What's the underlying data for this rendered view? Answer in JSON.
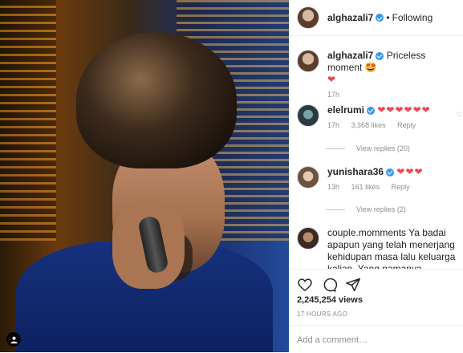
{
  "post": {
    "author": "alghazali7",
    "follow_status": "Following",
    "dot": "•"
  },
  "comments": [
    {
      "user": "alghazali7",
      "text": "Priceless moment 🤩",
      "extra": "❤",
      "time": "17h"
    },
    {
      "user": "elelrumi",
      "text": "❤❤❤❤❤❤",
      "time": "17h",
      "likes": "3,368 likes",
      "reply": "Reply",
      "view_replies": "View replies (20)"
    },
    {
      "user": "yunishara36",
      "text": "❤❤❤",
      "time": "13h",
      "likes": "161 likes",
      "reply": "Reply",
      "view_replies": "View replies (2)"
    },
    {
      "user": "couple.momments",
      "text": "Ya badai apapun yang telah menerjang kehidupan masa lalu keluarga kalian. Yang namanya keluarga"
    }
  ],
  "actions": {
    "views": "2,245,254 views",
    "timestamp": "17 HOURS AGO",
    "add_comment_placeholder": "Add a comment…"
  },
  "colors": {
    "verified": "#3897f0",
    "heart": "#ed4956",
    "muted": "#8e8e8e"
  }
}
